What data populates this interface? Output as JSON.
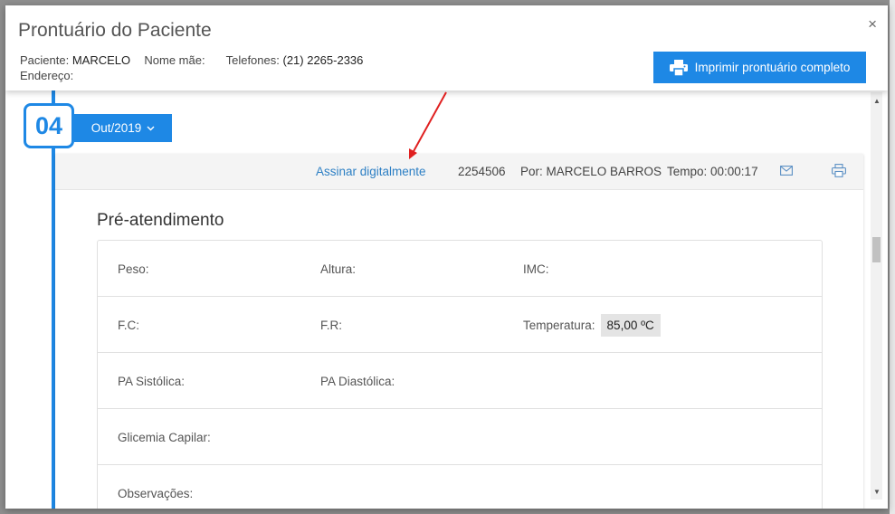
{
  "modal": {
    "title": "Prontuário do Paciente",
    "close_glyph": "×"
  },
  "patient": {
    "patient_label": "Paciente:",
    "patient_name": "MARCELO",
    "mother_label": "Nome mãe:",
    "phones_label": "Telefones:",
    "phones_value": "(21) 2265-2336",
    "address_label": "Endereço:"
  },
  "print_full": {
    "label": "Imprimir prontuário completo",
    "icon": "printer-icon"
  },
  "timeline": {
    "step": "04",
    "date_label": "Out/2019",
    "chevron_glyph": "⌄"
  },
  "record": {
    "sign_label": "Assinar digitalmente",
    "record_id": "2254506",
    "author": "Por: MARCELO BARROS",
    "duration": "Tempo: 00:00:17",
    "mail_icon": "envelope-icon",
    "print_icon": "printer-icon"
  },
  "pre_atendimento": {
    "title": "Pré-atendimento",
    "rows": [
      {
        "c1": "Peso:",
        "c2": "Altura:",
        "c3": "IMC:",
        "c3_value": ""
      },
      {
        "c1": "F.C:",
        "c2": "F.R:",
        "c3": "Temperatura:",
        "c3_value": "85,00 ºC"
      },
      {
        "c1": "PA Sistólica:",
        "c2": "PA Diastólica:",
        "c3": "",
        "c3_value": ""
      },
      {
        "c1": "Glicemia Capilar:",
        "c2": "",
        "c3": "",
        "c3_value": ""
      },
      {
        "c1": "Observações:",
        "c2": "",
        "c3": "",
        "c3_value": ""
      }
    ]
  },
  "scrollbar": {
    "up_glyph": "▲",
    "down_glyph": "▼"
  },
  "colors": {
    "accent": "#1e88e5",
    "link": "#2c7fc4",
    "annotation": "#e02020"
  }
}
